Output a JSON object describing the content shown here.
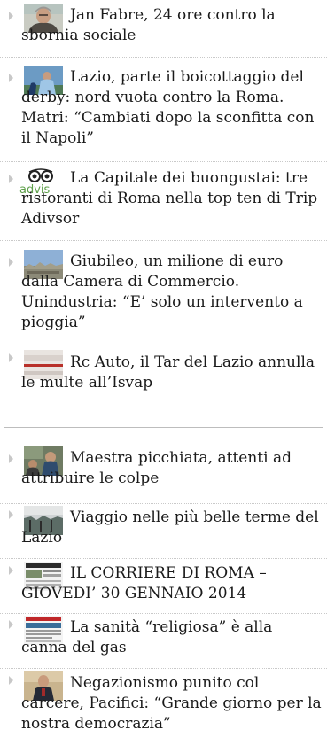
{
  "section1": {
    "items": [
      {
        "title": "Jan Fabre, 24 ore contro la sbornia sociale",
        "thumb": "portrait"
      },
      {
        "title": "Lazio, parte il boicottaggio del derby: nord vuota contro la Roma. Matri: “Cambiati dopo la sconfitta con il Napoli”",
        "thumb": "football"
      },
      {
        "title": "La Capitale dei buongustai: tre ristoranti di Roma nella top ten di Trip Adivsor",
        "thumb": "tripadvisor",
        "thumb_text": "advis"
      },
      {
        "title": "Giubileo, un milione di euro dalla Camera di Commercio. Unindustria: “E’ solo un intervento a pioggia”",
        "thumb": "cityscape"
      },
      {
        "title": "Rc Auto, il Tar del Lazio annulla le multe all’Isvap",
        "thumb": "building"
      }
    ]
  },
  "section2": {
    "items": [
      {
        "title": "Maestra picchiata, attenti ad attribuire le colpe",
        "thumb": "classroom"
      },
      {
        "title": "Viaggio nelle più belle terme del Lazio",
        "thumb": "spa"
      },
      {
        "title": "IL CORRIERE DI ROMA – GIOVEDI’ 30 GENNAIO 2014",
        "thumb": "newspaper"
      },
      {
        "title": "La sanità “religiosa” è alla canna del gas",
        "thumb": "newspaper-red"
      },
      {
        "title": "Negazionismo punito col carcere, Pacifici: “Grande giorno per la nostra democrazia”",
        "thumb": "speaker"
      }
    ]
  }
}
